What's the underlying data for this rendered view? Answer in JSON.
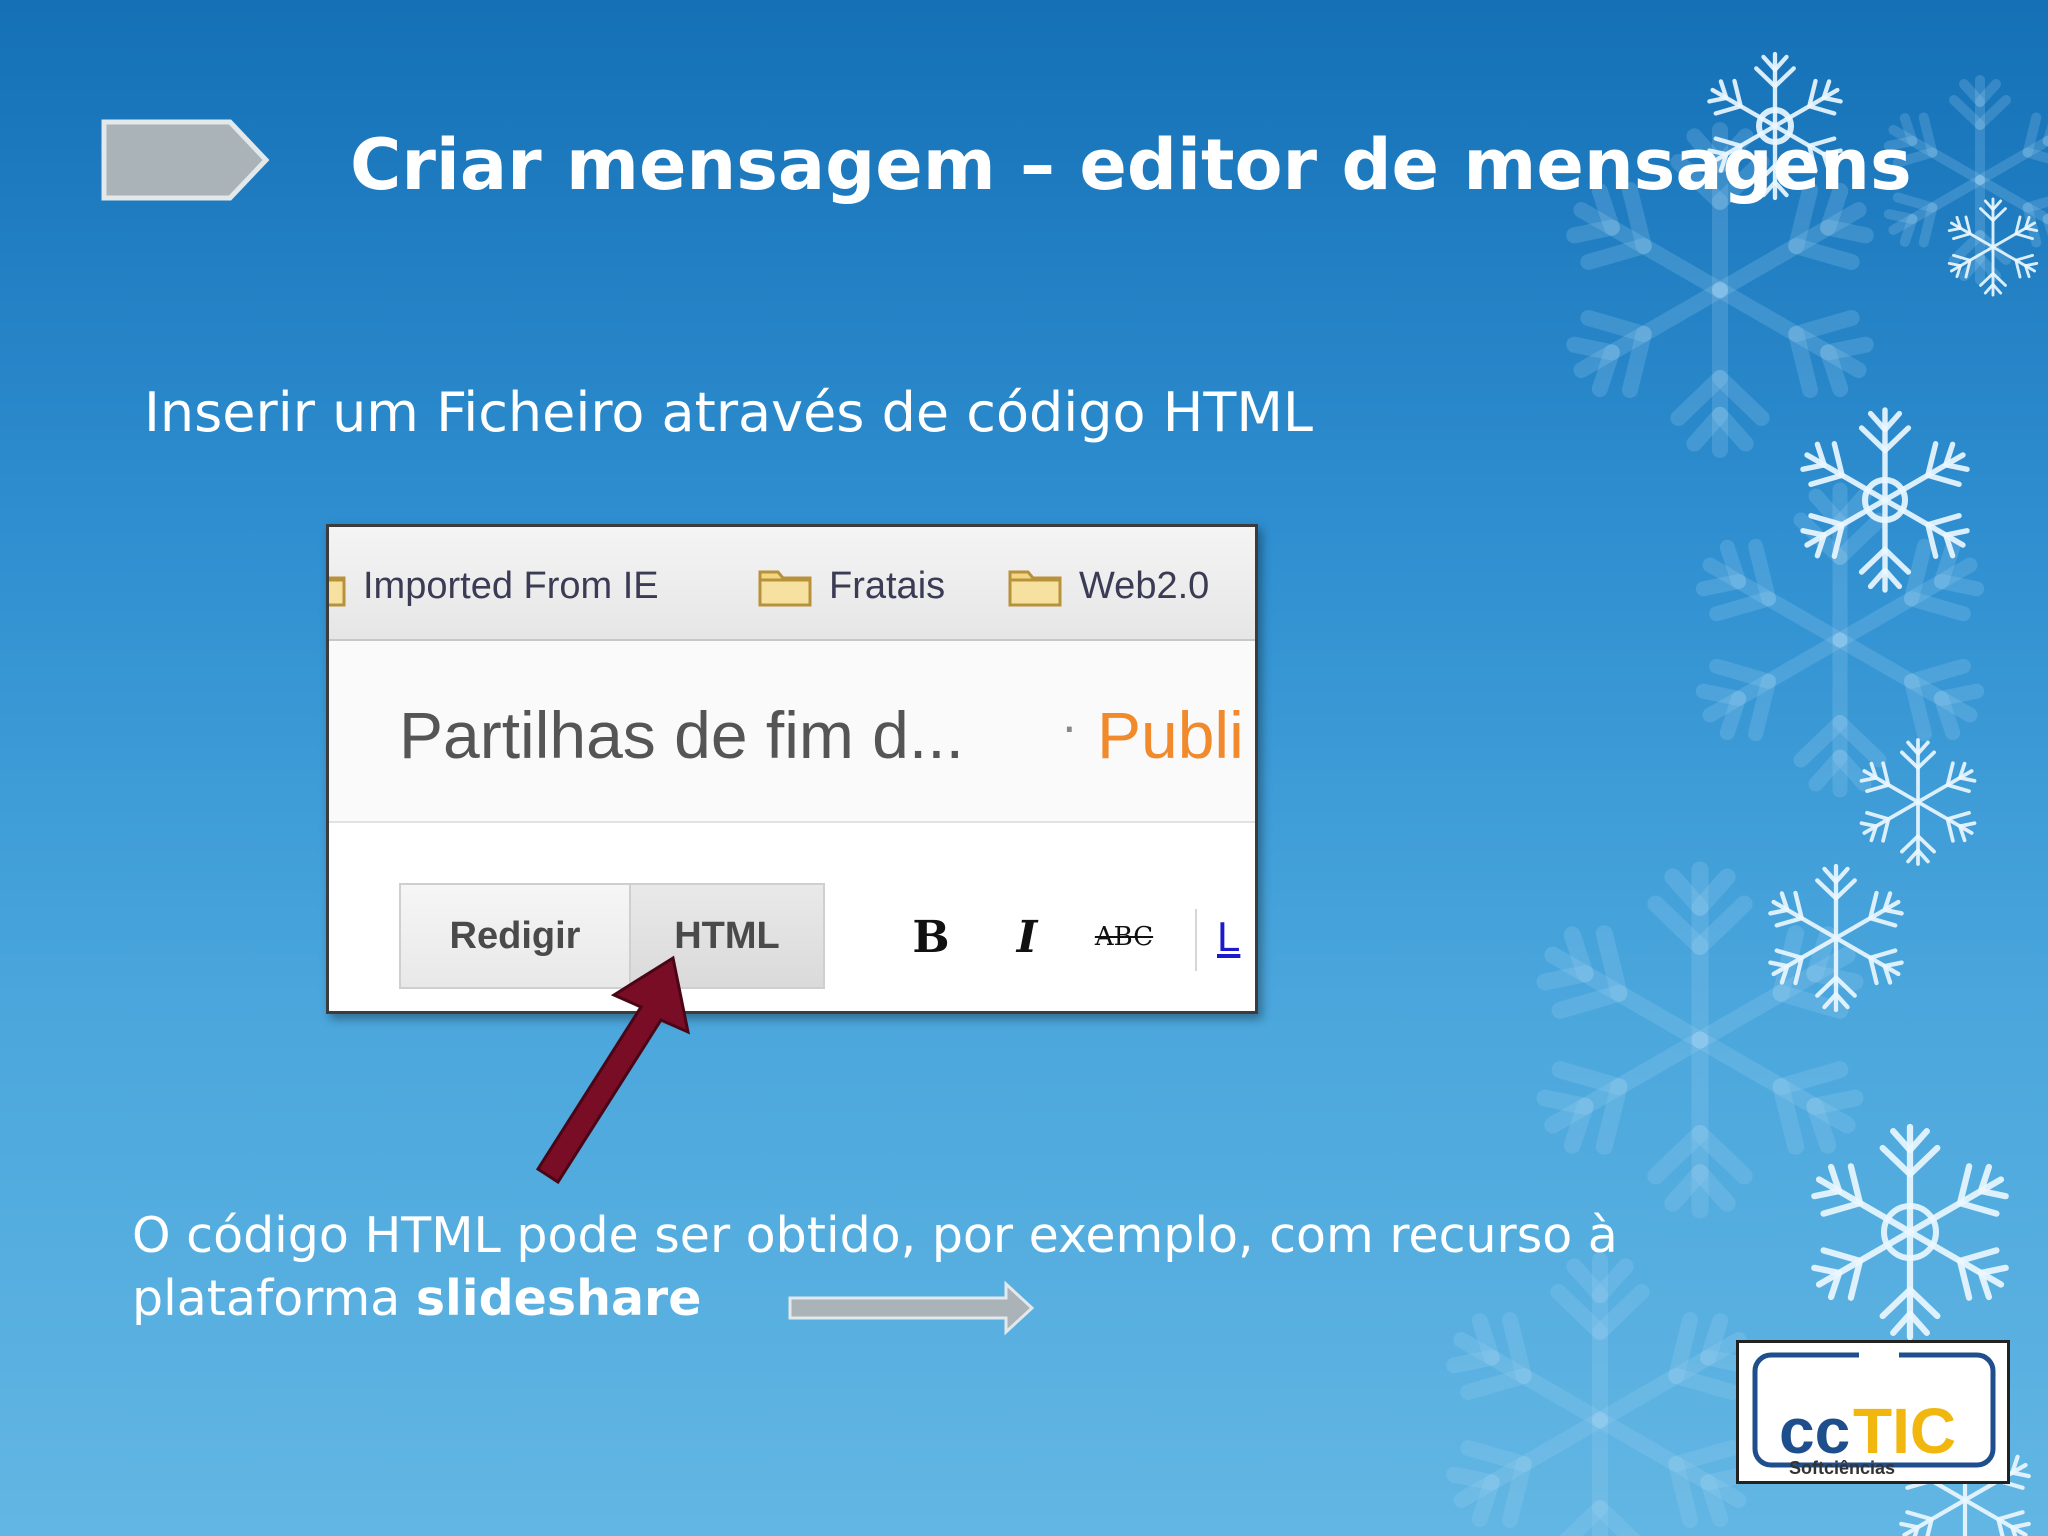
{
  "slide": {
    "title": "Criar mensagem – editor de mensagens",
    "subtitle": "Inserir um Ficheiro através de código HTML",
    "body_line1": "O código HTML pode ser obtido, por exemplo, com recurso à",
    "body_line2_prefix": "plataforma ",
    "body_line2_bold": "slideshare"
  },
  "screenshot": {
    "bookmarks": [
      {
        "label": "Imported From IE",
        "icon": "folder-icon"
      },
      {
        "label": "Fratais",
        "icon": "folder-icon"
      },
      {
        "label": "Web2.0",
        "icon": "folder-icon"
      }
    ],
    "post_title": "Partilhas de fim d...",
    "post_separator": "·",
    "post_action": "Publi",
    "tabs": {
      "compose": "Redigir",
      "html": "HTML"
    },
    "toolbar": {
      "bold": "B",
      "italic": "I",
      "strike": "ABC",
      "link": "L"
    }
  },
  "logo": {
    "brand": "ccTIC",
    "subtitle": "Softciências"
  },
  "colors": {
    "background_top": "#1570b6",
    "background_bottom": "#62b6e3",
    "pointer_arrow": "#7a0d26",
    "title_arrow": "#a9b3b8",
    "post_action": "#f08a2c",
    "logo_cc": "#1f4e8c",
    "logo_tic": "#f2b70f"
  }
}
